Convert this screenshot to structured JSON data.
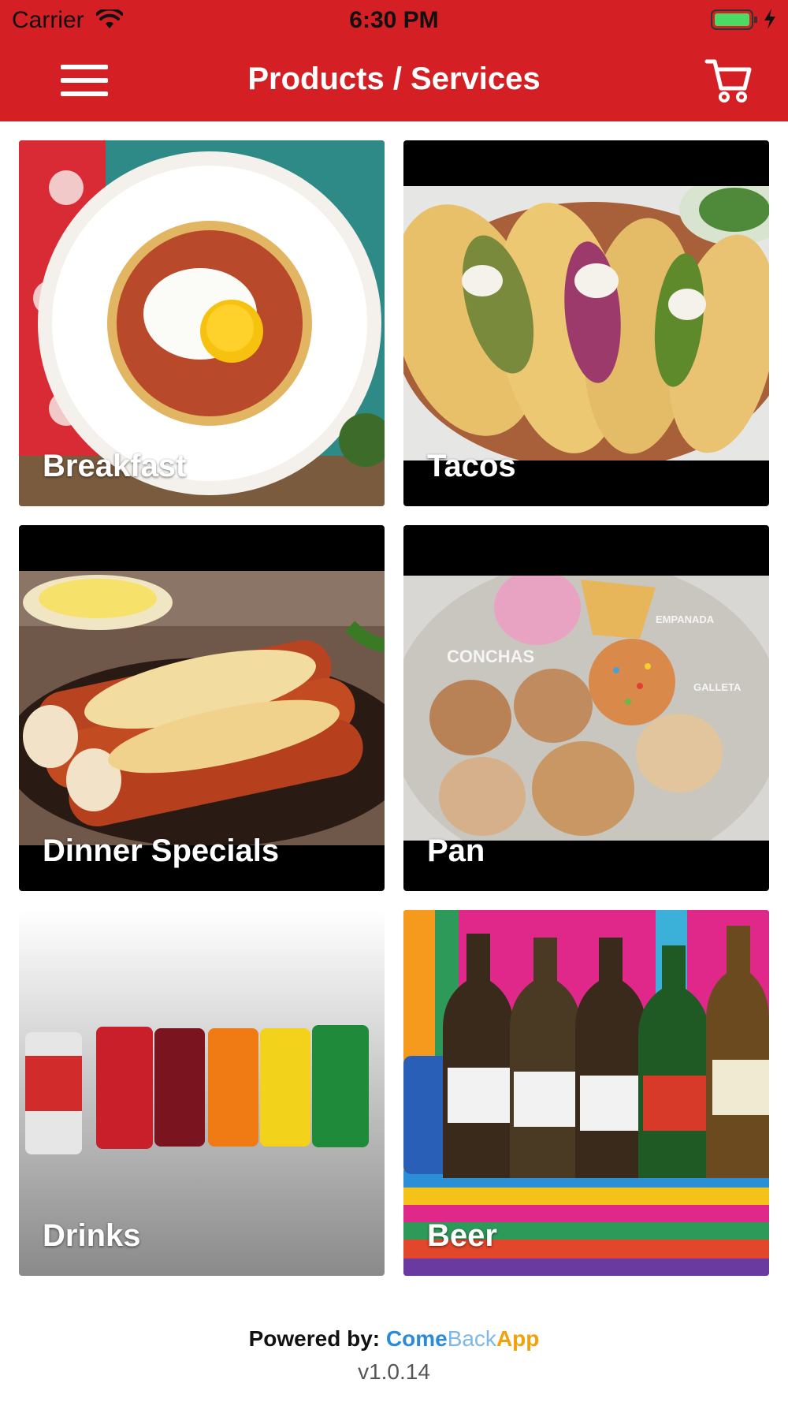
{
  "status_bar": {
    "carrier": "Carrier",
    "time": "6:30 PM"
  },
  "header": {
    "title": "Products / Services",
    "menu_icon": "hamburger-menu-icon",
    "cart_icon": "shopping-cart-icon"
  },
  "theme": {
    "primary": "#d41f25",
    "brand_come": "#2a8bd6",
    "brand_back": "#7fb7e6",
    "brand_app": "#f2a10b"
  },
  "categories": [
    {
      "label": "Breakfast"
    },
    {
      "label": "Tacos"
    },
    {
      "label": "Dinner Specials"
    },
    {
      "label": "Pan"
    },
    {
      "label": "Drinks"
    },
    {
      "label": "Beer"
    }
  ],
  "pan_image_text": {
    "conchas": "CONCHAS",
    "empanada": "EMPANADA",
    "galleta": "GALLETA"
  },
  "footer": {
    "powered_by": "Powered by:",
    "brand_part1": "Come",
    "brand_part2": "Back",
    "brand_part3": "App",
    "version": "v1.0.14"
  }
}
